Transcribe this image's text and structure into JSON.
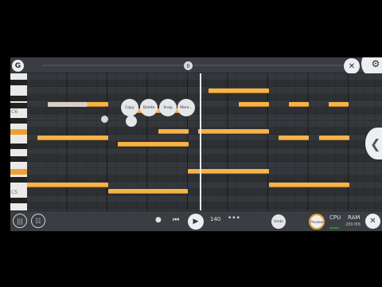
{
  "topbar": {
    "back_icon": "G",
    "scroll_thumb_label": "II",
    "tool_icon": "✕",
    "tool_icon_2": "⚙"
  },
  "keyboard": {
    "labels": [
      "C6",
      "C5"
    ]
  },
  "context_menu": {
    "copy": "Copy",
    "delete": "Delete",
    "snap": "Snap",
    "more": "More..."
  },
  "transport": {
    "play_icon": "▶",
    "rewind_icon": "⏮",
    "tempo": "140",
    "undo": "Undo",
    "preview": "Preview",
    "cpu": "CPU",
    "ram": "RAM",
    "ram_value": "289 MB",
    "close_icon": "✕"
  },
  "colors": {
    "note": "#f6b348",
    "background": "#2f3236",
    "accent": "#e0a030"
  }
}
